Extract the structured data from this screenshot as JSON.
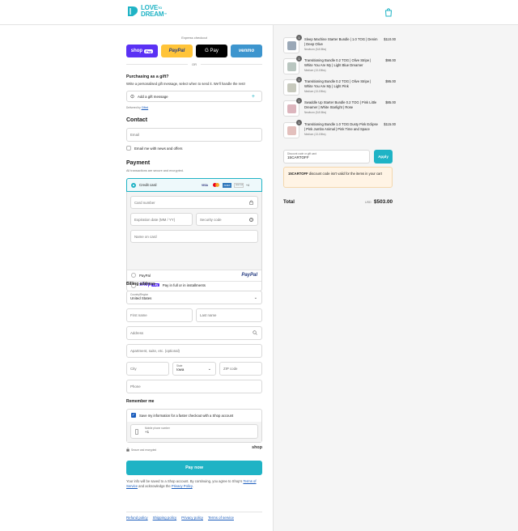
{
  "brand": {
    "line1": "LOVE",
    "to": "TO",
    "line2": "DREAM",
    "tm": "™",
    "accent": "#1fb3c5"
  },
  "express": {
    "title": "Express checkout",
    "buttons": [
      {
        "label": "shop",
        "badge": "Pay",
        "bg": "#5a31f4",
        "color": "#ffffff"
      },
      {
        "label": "PayPal",
        "bg": "#ffc439",
        "color": "#253b80"
      },
      {
        "label": "G Pay",
        "bg": "#000000",
        "color": "#ffffff"
      },
      {
        "label": "venmo",
        "bg": "#3d95ce",
        "color": "#ffffff"
      }
    ],
    "or": "OR"
  },
  "gift": {
    "title": "Purchasing as a gift?",
    "desc": "Write a personalised gift message, select when to send it. We'll handle the rest!",
    "add_label": "Add a gift message",
    "delivered_by": "Delivered by",
    "delivered_link": "Gifted"
  },
  "contact": {
    "title": "Contact",
    "email_placeholder": "Email",
    "newsletter": "Email me with news and offers"
  },
  "payment": {
    "title": "Payment",
    "subtitle": "All transactions are secure and encrypted.",
    "credit_card": "Credit card",
    "card_brands": [
      "VISA",
      "MC",
      "AMEX",
      "DISCOVER"
    ],
    "more_cards": "+4",
    "card_number": "Card number",
    "expiry": "Expiration date (MM / YY)",
    "cvv": "Security code",
    "name_on_card": "Name on card",
    "paypal": "PayPal",
    "paypal_logo": "PayPal",
    "shoppay_logo": "shop",
    "shoppay_badge": "Pay",
    "shoppay_text": "Pay in full or in installments"
  },
  "billing": {
    "title": "Billing address",
    "country_label": "Country/Region",
    "country_value": "United States",
    "first_name": "First name",
    "last_name": "Last name",
    "address": "Address",
    "apartment": "Apartment, suite, etc. (optional)",
    "city": "City",
    "state_label": "State",
    "state_value": "Iowa",
    "zip": "ZIP code",
    "phone": "Phone"
  },
  "remember": {
    "title": "Remember me",
    "save_text": "Save my information for a faster checkout with a Shop account",
    "mobile_label": "Mobile phone number",
    "mobile_value": "+1",
    "secure": "Secure and encrypted",
    "shop": "shop"
  },
  "pay_now": "Pay now",
  "legal": {
    "text1": "Your info will be saved to a Shop account. By continuing, you agree to Shop's",
    "terms": "Terms of Service",
    "text2": "and acknowledge the",
    "privacy": "Privacy Policy",
    "end": "."
  },
  "footer": [
    "Refund policy",
    "Shipping policy",
    "Privacy policy",
    "Terms of service"
  ],
  "order": {
    "items": [
      {
        "qty": "1",
        "name": "Sleep Machine Starter Bundle | 1.0 TOG | Denim | Deep Olive",
        "variant": "Newborn (5-8.5lbs)",
        "price": "$110.00"
      },
      {
        "qty": "1",
        "name": "Transitioning Bundle 0.2 TOG | Olive Stripe | White You Are My | Light Blue Dreamer",
        "variant": "Medium (13-19lbs)",
        "price": "$98.00"
      },
      {
        "qty": "1",
        "name": "Transitioning Bundle 0.2 TOG | Olive Stripe | White You Are My | Light Pink",
        "variant": "Medium (13-19lbs)",
        "price": "$95.00"
      },
      {
        "qty": "1",
        "name": "Swaddle Up Starter Bundle 0.2 TOG | Pink Little Dreamer | White Starlight | Rose",
        "variant": "Newborn (5-8.5lbs)",
        "price": "$85.00"
      },
      {
        "qty": "1",
        "name": "Transitioning Bundle 1.0 TOG Dusty Pink Eclipse | Pink Jumbo Animal | Pink Time and Space",
        "variant": "Medium (13-19lbs)",
        "price": "$115.00"
      }
    ],
    "discount_label": "Discount code or gift card",
    "discount_value": "15CARTOFF",
    "apply": "Apply",
    "warning_code": "15CARTOFF",
    "warning_text": "discount code isn't valid for the items in your cart",
    "total_label": "Total",
    "currency": "USD",
    "total": "$503.00"
  }
}
